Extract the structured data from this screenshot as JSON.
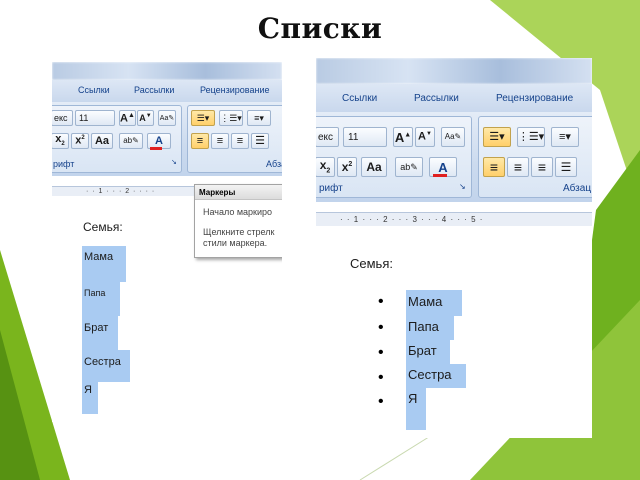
{
  "slide": {
    "title": "Списки"
  },
  "colors": {
    "accent_green": "#7ab51d",
    "accent_green_dark": "#4f8a10",
    "selection": "#a9cbf2",
    "ribbon_text": "#15428b",
    "font_color_bar": "#e02020"
  },
  "left": {
    "tabs": [
      "Ссылки",
      "Рассылки",
      "Рецензирование"
    ],
    "font_name": "екс",
    "font_size": "11",
    "group_font_label": "рифт",
    "group_para_label": "Абзац",
    "ruler": "· · 1 · · · 2 · · · ·",
    "popup": {
      "title": "Маркеры",
      "line1": "Начало маркиро",
      "line2": "Щелкните стрелк",
      "line3": "стили маркера."
    },
    "heading": "Семья:",
    "items": [
      "Мама",
      "Папа",
      "Брат",
      "Сестра",
      "Я"
    ]
  },
  "right": {
    "tabs": [
      "Ссылки",
      "Рассылки",
      "Рецензирование"
    ],
    "font_name": "екс",
    "font_size": "11",
    "group_font_label": "рифт",
    "group_para_label": "Абзац",
    "ruler": "· · 1 · · · 2 · · · 3 · · · 4 · · · 5 ·",
    "heading": "Семья:",
    "bullet_char": "•",
    "items": [
      "Мама",
      "Папа",
      "Брат",
      "Сестра",
      "Я"
    ]
  },
  "icons": [
    "bullets-icon",
    "numbering-icon",
    "multilevel-list-icon",
    "grow-font-icon",
    "shrink-font-icon",
    "clear-formatting-icon",
    "subscript-icon",
    "superscript-icon",
    "change-case-icon",
    "highlight-icon",
    "font-color-icon",
    "align-left-icon",
    "align-center-icon",
    "align-right-icon",
    "justify-icon",
    "dialog-launcher-icon"
  ]
}
